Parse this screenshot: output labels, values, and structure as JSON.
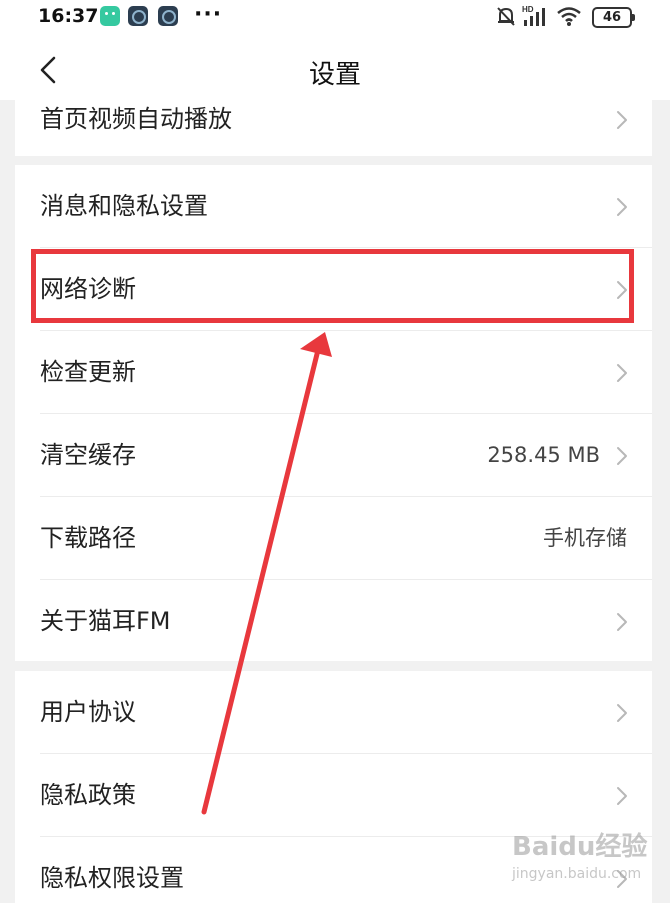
{
  "status_bar": {
    "time": "16:37",
    "more": "···",
    "network_type": "HD",
    "battery": "46"
  },
  "nav": {
    "title": "设置"
  },
  "groups": [
    {
      "items": [
        {
          "label": "首页视频自动播放",
          "partial": true
        }
      ]
    },
    {
      "items": [
        {
          "label": "消息和隐私设置",
          "value": "",
          "chevron": true
        },
        {
          "label": "网络诊断",
          "value": "",
          "chevron": true,
          "highlighted": true
        },
        {
          "label": "检查更新",
          "value": "",
          "chevron": true
        },
        {
          "label": "清空缓存",
          "value": "258.45 MB",
          "chevron": true
        },
        {
          "label": "下载路径",
          "value": "手机存储",
          "chevron": false
        },
        {
          "label": "关于猫耳FM",
          "value": "",
          "chevron": true
        }
      ]
    },
    {
      "items": [
        {
          "label": "用户协议",
          "value": "",
          "chevron": true
        },
        {
          "label": "隐私政策",
          "value": "",
          "chevron": true
        },
        {
          "label": "隐私权限设置",
          "value": "",
          "chevron": true
        }
      ]
    }
  ],
  "annotation": {
    "color": "#e8383d",
    "shape": "rectangle-and-arrow",
    "target": "网络诊断"
  },
  "watermark": {
    "logo": "Baidu经验",
    "sub": "jingyan.baidu.com"
  },
  "colors": {
    "background": "#f1f1f1",
    "surface": "#ffffff",
    "text": "#222222",
    "secondary_text": "#444444",
    "chevron": "#b8b8b8",
    "divider": "#ececec"
  }
}
